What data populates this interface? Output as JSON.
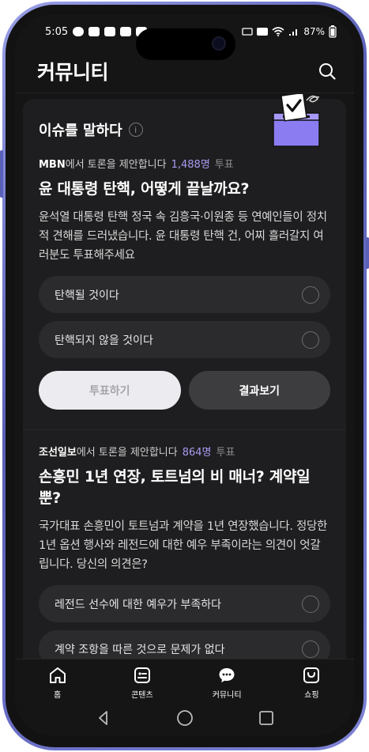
{
  "status_bar": {
    "time": "5:05",
    "battery": "87%"
  },
  "header": {
    "title": "커뮤니티"
  },
  "issue_section": {
    "title": "이슈를 말하다",
    "info_symbol": "i"
  },
  "polls": [
    {
      "source": "MBN",
      "source_suffix": "에서 토론을 제안합니다",
      "vote_count": "1,488명",
      "vote_label": "투표",
      "question": "윤 대통령 탄핵, 어떻게 끝날까요?",
      "description": "윤석열 대통령 탄핵 정국 속 김흥국·이원종 등 연예인들이 정치적 견해를 드러냈습니다. 윤 대통령 탄핵 건, 어찌 흘러갈지 여러분도 투표해주세요",
      "options": [
        "탄핵될 것이다",
        "탄핵되지 않을 것이다"
      ],
      "vote_button": "투표하기",
      "result_button": "결과보기"
    },
    {
      "source": "조선일보",
      "source_suffix": "에서 토론을 제안합니다",
      "vote_count": "864명",
      "vote_label": "투표",
      "question": "손흥민 1년 연장, 토트넘의 비 매너? 계약일 뿐?",
      "description": "국가대표 손흥민이 토트넘과 계약을 1년 연장했습니다. 정당한 1년 옵션 행사와 레전드에 대한 예우 부족이라는 의견이 엇갈립니다. 당신의 의견은?",
      "options": [
        "레전드 선수에 대한 예우가 부족하다",
        "계약 조항을 따른 것으로 문제가 없다"
      ]
    }
  ],
  "bottom_nav": [
    {
      "label": "홈",
      "icon": "home-icon"
    },
    {
      "label": "콘텐츠",
      "icon": "content-icon"
    },
    {
      "label": "커뮤니티",
      "icon": "community-icon"
    },
    {
      "label": "쇼핑",
      "icon": "shopping-icon"
    }
  ],
  "colors": {
    "accent_count": "#a79bf0",
    "ballot_box": "#8b7cf2",
    "background": "#151516",
    "card": "#1e1e20"
  }
}
